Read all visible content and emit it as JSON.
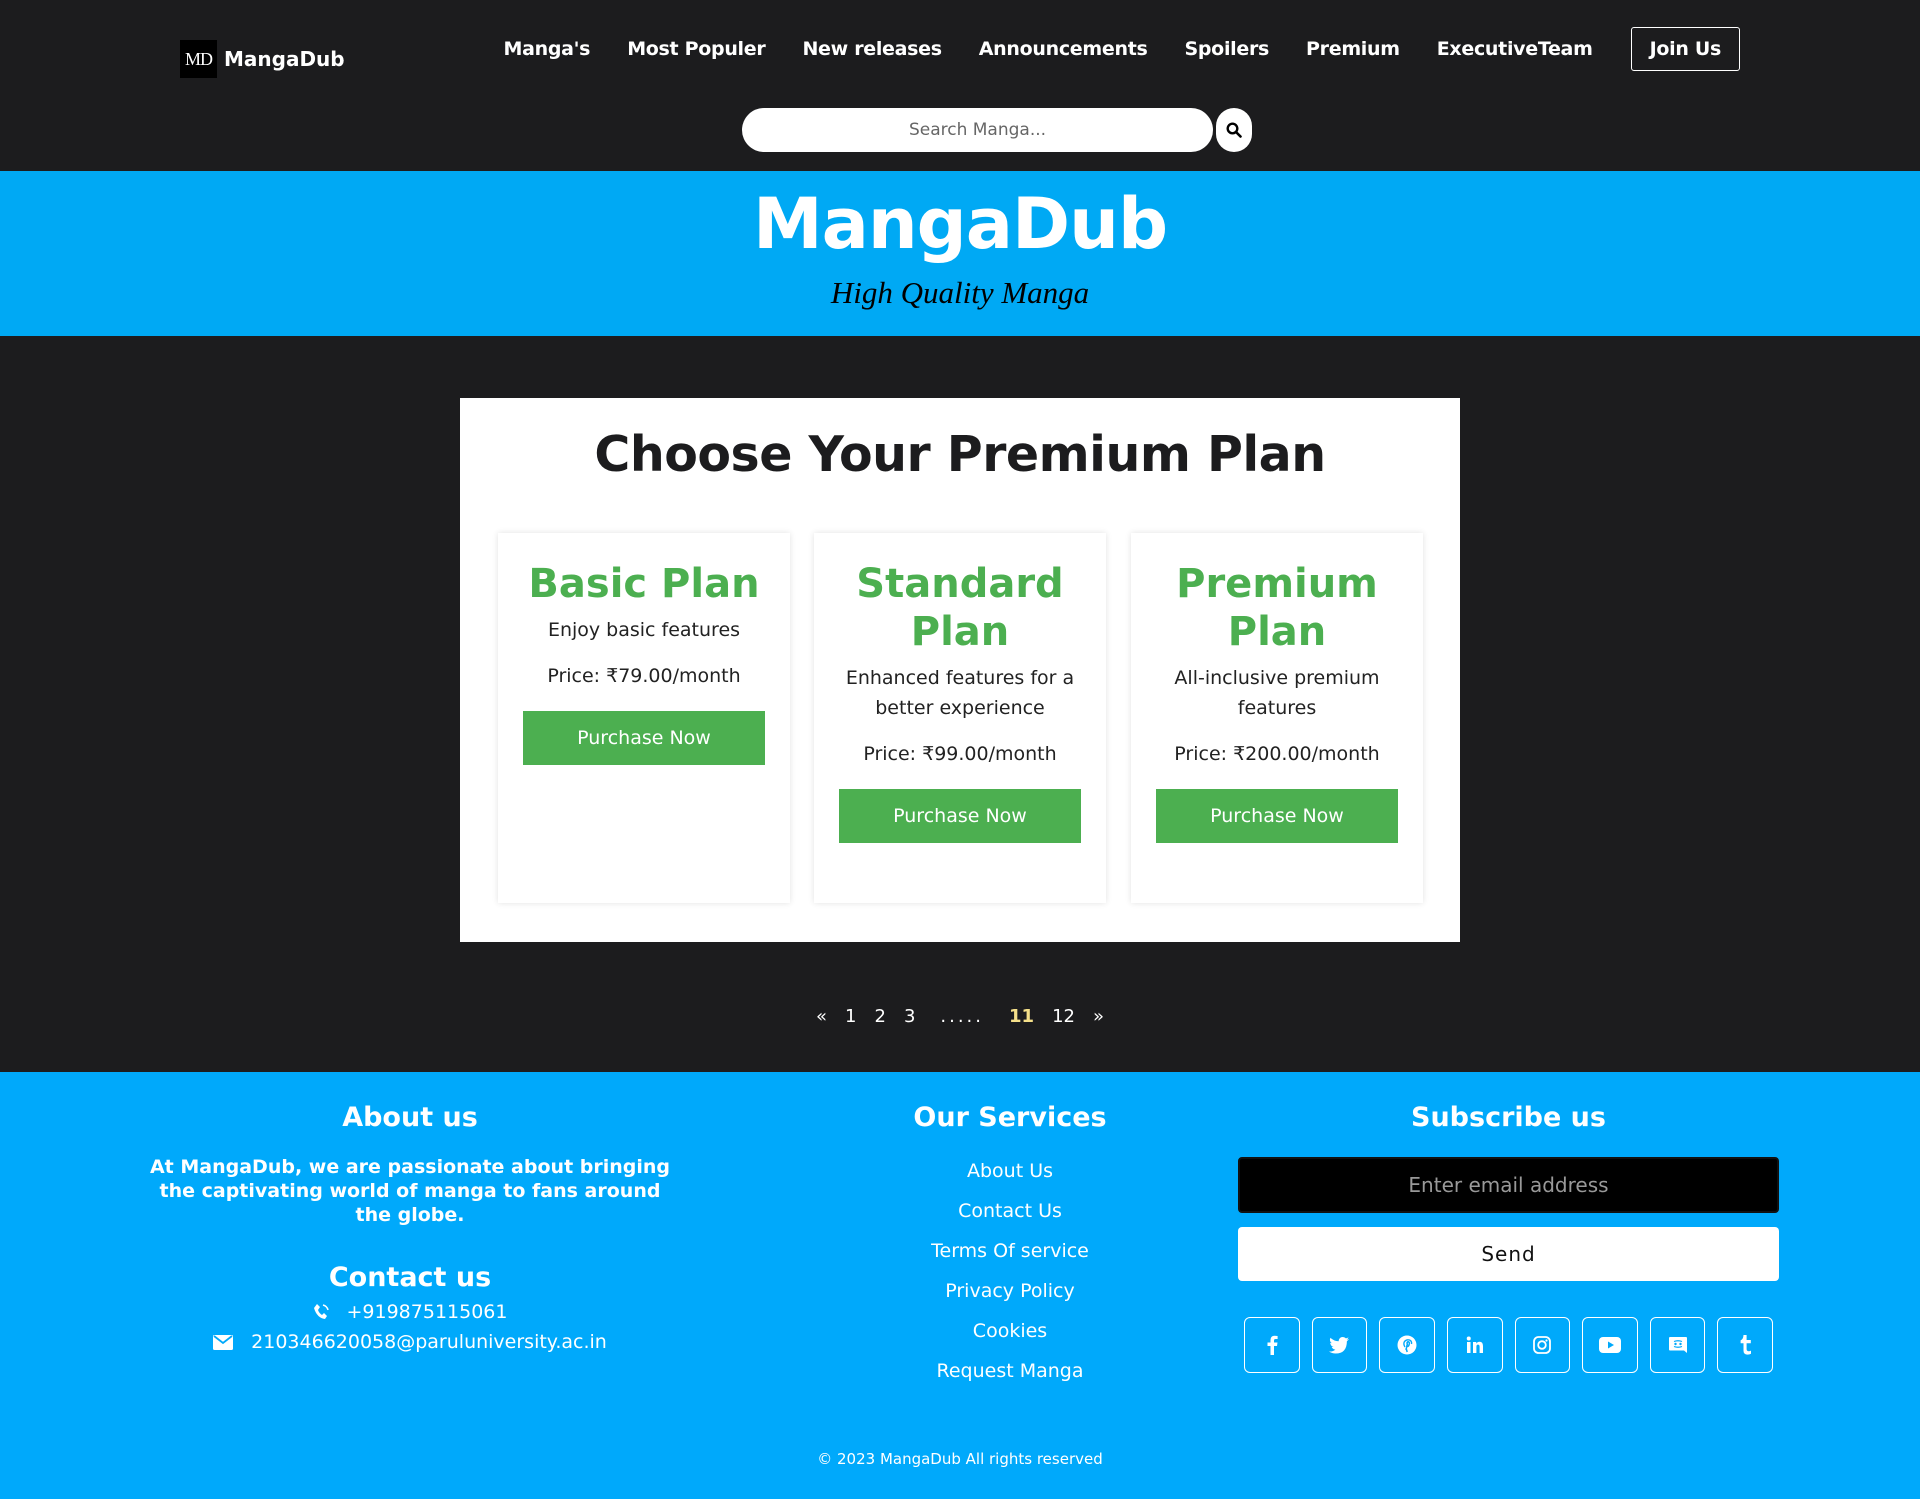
{
  "header": {
    "logo_text": "MD",
    "brand": "MangaDub",
    "nav": [
      "Manga's",
      "Most Populer",
      "New releases",
      "Announcements",
      "Spoilers",
      "Premium",
      "ExecutiveTeam"
    ],
    "join_label": "Join Us",
    "search_placeholder": "Search Manga..."
  },
  "hero": {
    "title": "MangaDub",
    "subtitle": "High Quality Manga"
  },
  "plans": {
    "heading": "Choose Your Premium Plan",
    "items": [
      {
        "title": "Basic Plan",
        "description": "Enjoy basic features",
        "price": "Price: ₹79.00/month",
        "button": "Purchase Now"
      },
      {
        "title": "Standard Plan",
        "description": "Enhanced features for a better experience",
        "price": "Price: ₹99.00/month",
        "button": "Purchase Now"
      },
      {
        "title": "Premium Plan",
        "description": "All-inclusive premium features",
        "price": "Price: ₹200.00/month",
        "button": "Purchase Now"
      }
    ]
  },
  "pagination": {
    "prev": "«",
    "pages": [
      "1",
      "2",
      "3"
    ],
    "dots": ".....",
    "current": "11",
    "last": "12",
    "next": "»"
  },
  "footer": {
    "about_heading": "About us",
    "about_text": "At MangaDub, we are passionate about bringing the captivating world of manga to fans around the globe.",
    "contact_heading": "Contact us",
    "phone": "+919875115061",
    "email": "210346620058@paruluniversity.ac.in",
    "services_heading": "Our Services",
    "services": [
      "About Us",
      "Contact Us",
      "Terms Of service",
      "Privacy Policy",
      "Cookies",
      "Request Manga"
    ],
    "subscribe_heading": "Subscribe us",
    "email_placeholder": "Enter email address",
    "send_label": "Send",
    "socials": [
      "facebook-icon",
      "twitter-icon",
      "pinterest-icon",
      "linkedin-icon",
      "instagram-icon",
      "youtube-icon",
      "discord-icon",
      "tumblr-icon"
    ],
    "copyright": "© 2023 MangaDub All rights reserved"
  },
  "colors": {
    "header_bg": "#1c1c1e",
    "hero_bg": "#00a9f4",
    "accent_green": "#4caf50",
    "footer_bg": "#00a9fb",
    "active_page": "#f5e08a"
  }
}
